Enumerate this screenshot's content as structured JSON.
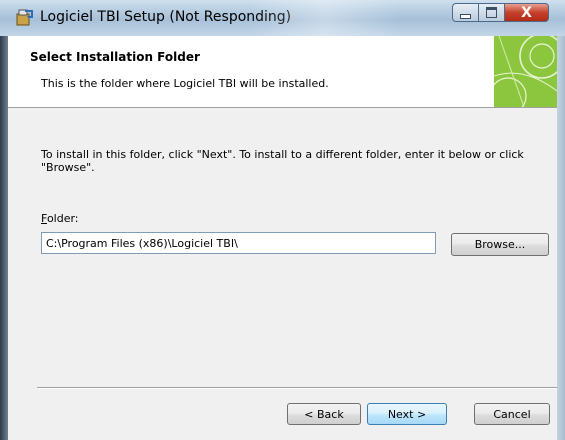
{
  "window": {
    "title": "Logiciel TBI Setup (Not Responding)",
    "minimize_icon": "minimize-icon",
    "maximize_icon": "maximize-icon",
    "close_glyph": "X"
  },
  "header": {
    "title": "Select Installation Folder",
    "description": "This is the folder where Logiciel TBI will be installed.",
    "banner_color": "#8cc63f"
  },
  "body": {
    "instruction": "To install in this folder, click \"Next\". To install to a different folder, enter it below or click \"Browse\"."
  },
  "folder": {
    "label_accel": "F",
    "label_rest": "older:",
    "value": "C:\\Program Files (x86)\\Logiciel TBI\\"
  },
  "buttons": {
    "browse": "Browse...",
    "back": "< Back",
    "next": "Next >",
    "cancel": "Cancel"
  }
}
